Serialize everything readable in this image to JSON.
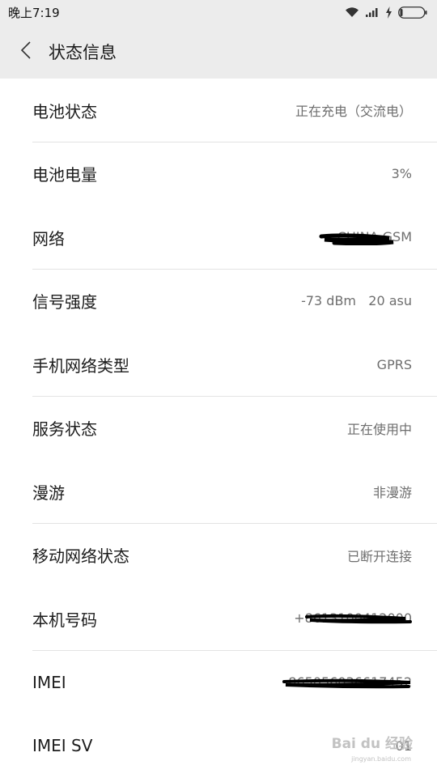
{
  "status_bar": {
    "time": "晚上7:19",
    "icons": [
      "wifi-icon",
      "signal-icon",
      "charging-icon",
      "battery-icon"
    ]
  },
  "header": {
    "back_icon": "chevron-left-icon",
    "title": "状态信息"
  },
  "rows": [
    {
      "label": "电池状态",
      "value": "正在充电（交流电）"
    },
    {
      "label": "电池电量",
      "value": "3%"
    },
    {
      "label": "网络",
      "value": "CHINA GSM",
      "redacted": true
    },
    {
      "label": "信号强度",
      "value": "-73 dBm   20 asu"
    },
    {
      "label": "手机网络类型",
      "value": "GPRS"
    },
    {
      "label": "服务状态",
      "value": "正在使用中"
    },
    {
      "label": "漫游",
      "value": "非漫游"
    },
    {
      "label": "移动网络状态",
      "value": "已断开连接"
    },
    {
      "label": "本机号码",
      "value": "+8613100412000",
      "redacted": true
    },
    {
      "label": "IMEI",
      "value": "865056036617452",
      "redacted": true
    },
    {
      "label": "IMEI SV",
      "value": "01"
    }
  ],
  "watermark": {
    "text": "Bai du 经验",
    "sub": "jingyan.baidu.com"
  }
}
